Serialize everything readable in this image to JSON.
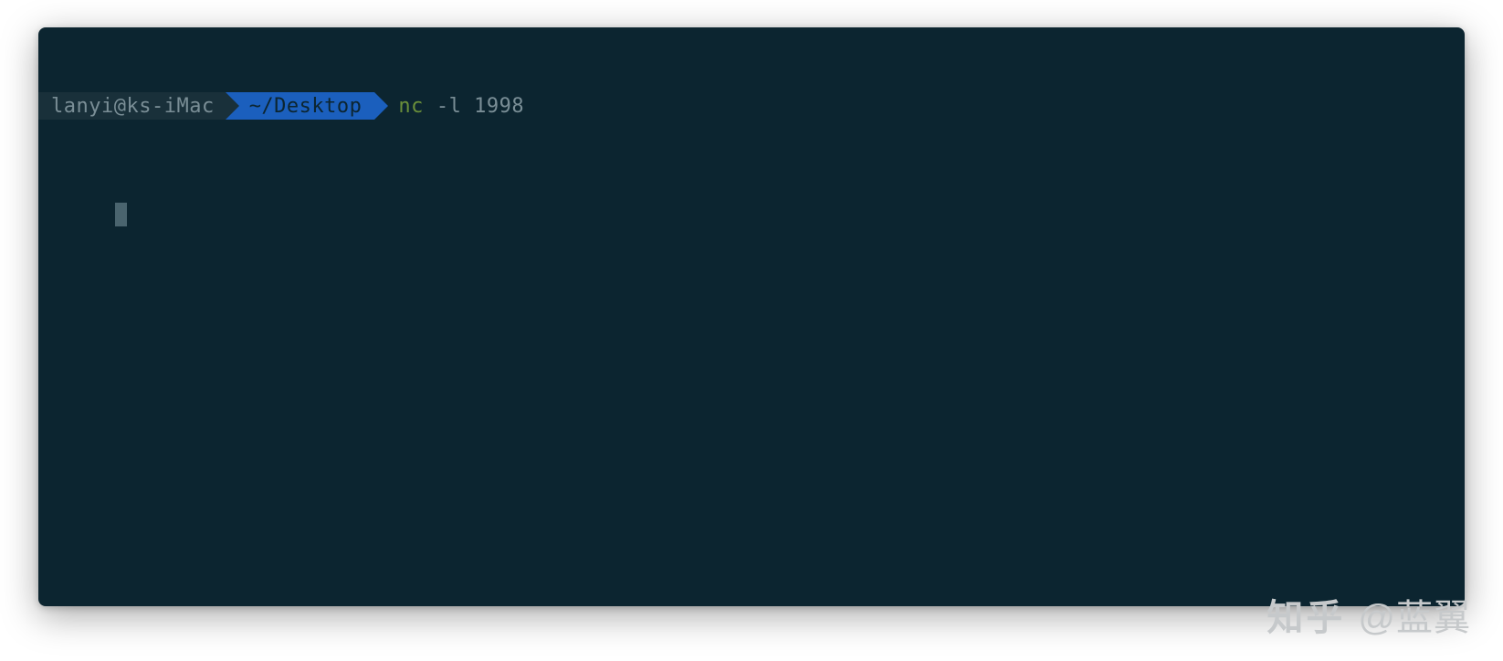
{
  "terminal": {
    "prompt": {
      "user_host": "lanyi@ks-iMac",
      "path": "~/Desktop"
    },
    "command": {
      "name": "nc",
      "args": "-l 1998"
    }
  },
  "watermark": {
    "logo": "知乎",
    "author": "@蓝翼"
  }
}
